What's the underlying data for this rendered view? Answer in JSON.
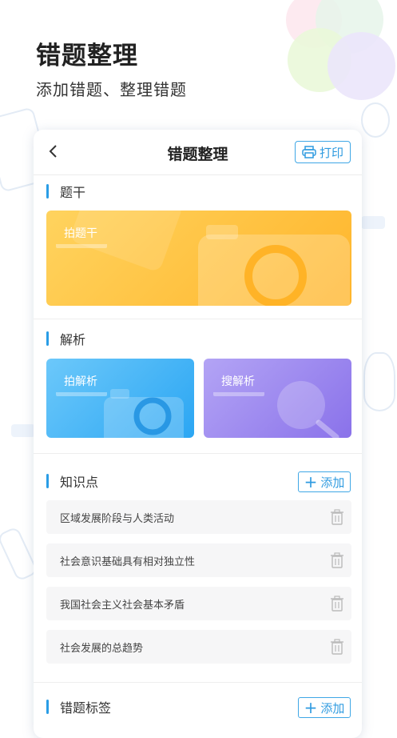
{
  "hero": {
    "title": "错题整理",
    "subtitle": "添加错题、整理错题"
  },
  "topbar": {
    "title": "错题整理",
    "print_label": "打印"
  },
  "sections": {
    "stem": {
      "label": "题干",
      "tile_label": "拍题干"
    },
    "analysis": {
      "label": "解析",
      "photo_label": "拍解析",
      "search_label": "搜解析"
    },
    "knowledge": {
      "label": "知识点",
      "add_label": "添加",
      "items": [
        "区域发展阶段与人类活动",
        "社会意识基础具有相对独立性",
        "我国社会主义社会基本矛盾",
        "社会发展的总趋势"
      ]
    },
    "tags": {
      "label": "错题标签",
      "add_label": "添加"
    }
  },
  "colors": {
    "accent": "#2a9de6",
    "stem_tile": "#ffc23e",
    "photo_tile": "#42b2f5",
    "search_tile": "#9a86ef"
  },
  "icons": [
    "back-arrow-icon",
    "printer-icon",
    "camera-icon",
    "magnifier-icon",
    "plus-icon",
    "trash-icon"
  ]
}
